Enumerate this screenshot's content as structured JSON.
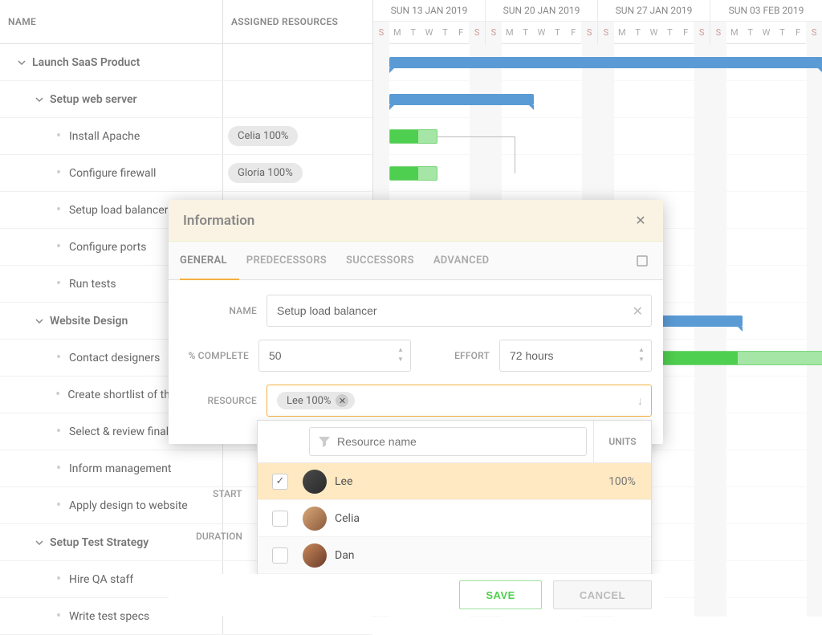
{
  "columns": {
    "name": "NAME",
    "resources": "ASSIGNED RESOURCES"
  },
  "timeline": {
    "weeks": [
      {
        "label": "SUN 13 JAN 2019",
        "days": [
          "S",
          "M",
          "T",
          "W",
          "T",
          "F",
          "S"
        ]
      },
      {
        "label": "SUN 20 JAN 2019",
        "days": [
          "S",
          "M",
          "T",
          "W",
          "T",
          "F",
          "S"
        ]
      },
      {
        "label": "SUN 27 JAN 2019",
        "days": [
          "S",
          "M",
          "T",
          "W",
          "T",
          "F",
          "S"
        ]
      },
      {
        "label": "SUN 03 FEB 2019",
        "days": [
          "S",
          "M",
          "T",
          "W",
          "T",
          "F",
          "S"
        ]
      }
    ]
  },
  "tasks": [
    {
      "label": "Launch SaaS Product",
      "type": "parent",
      "indent": 0
    },
    {
      "label": "Setup web server",
      "type": "parent",
      "indent": 1
    },
    {
      "label": "Install Apache",
      "type": "leaf",
      "indent": 2,
      "resource": "Celia 100%"
    },
    {
      "label": "Configure firewall",
      "type": "leaf",
      "indent": 2,
      "resource": "Gloria 100%"
    },
    {
      "label": "Setup load balancer",
      "type": "leaf",
      "indent": 2
    },
    {
      "label": "Configure ports",
      "type": "leaf",
      "indent": 2
    },
    {
      "label": "Run tests",
      "type": "leaf",
      "indent": 2
    },
    {
      "label": "Website Design",
      "type": "parent",
      "indent": 1
    },
    {
      "label": "Contact designers",
      "type": "leaf",
      "indent": 2
    },
    {
      "label": "Create shortlist of three designers",
      "type": "leaf",
      "indent": 2
    },
    {
      "label": "Select & review final design",
      "type": "leaf",
      "indent": 2
    },
    {
      "label": "Inform management",
      "type": "leaf",
      "indent": 2
    },
    {
      "label": "Apply design to website",
      "type": "leaf",
      "indent": 2
    },
    {
      "label": "Setup Test Strategy",
      "type": "parent",
      "indent": 1
    },
    {
      "label": "Hire QA staff",
      "type": "leaf",
      "indent": 2
    },
    {
      "label": "Write test specs",
      "type": "leaf",
      "indent": 2
    }
  ],
  "modal": {
    "title": "Information",
    "tabs": {
      "general": "GENERAL",
      "predecessors": "PREDECESSORS",
      "successors": "SUCCESSORS",
      "advanced": "ADVANCED"
    },
    "form": {
      "name_label": "NAME",
      "name_value": "Setup load balancer",
      "complete_label": "% COMPLETE",
      "complete_value": "50",
      "effort_label": "EFFORT",
      "effort_value": "72 hours",
      "resource_label": "RESOURCE",
      "resource_chip": "Lee 100%",
      "start_label": "START",
      "duration_label": "DURATION"
    },
    "dropdown": {
      "filter_placeholder": "Resource name",
      "units_header": "UNITS",
      "rows": [
        {
          "name": "Lee",
          "units": "100%",
          "checked": true
        },
        {
          "name": "Celia",
          "units": "",
          "checked": false
        },
        {
          "name": "Dan",
          "units": "",
          "checked": false
        }
      ]
    },
    "buttons": {
      "save": "SAVE",
      "cancel": "CANCEL"
    }
  }
}
